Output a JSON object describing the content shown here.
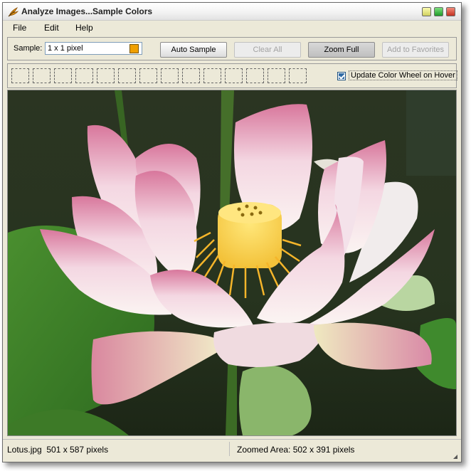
{
  "window": {
    "title": "Analyze Images...Sample Colors",
    "icon": "flame-app-icon"
  },
  "menu": [
    {
      "label": "File"
    },
    {
      "label": "Edit"
    },
    {
      "label": "Help"
    }
  ],
  "toolbar": {
    "sample_label": "Sample:",
    "sample_value": "1 x 1 pixel",
    "sample_color": "#f0a000",
    "auto_sample": "Auto Sample",
    "clear_all": "Clear All",
    "zoom_full": "Zoom Full",
    "add_to_favorites": "Add to Favorites"
  },
  "swatches": {
    "slot_count": 14,
    "update_on_hover_label": "Update Color Wheel on Hover",
    "update_on_hover_checked": true
  },
  "status": {
    "file_info": "Lotus.jpg  501 x 587 pixels",
    "zoomed_area": "Zoomed Area: 502 x 391 pixels"
  },
  "colors": {
    "window_bg": "#ece9d8",
    "accent": "#2f6aa3"
  }
}
